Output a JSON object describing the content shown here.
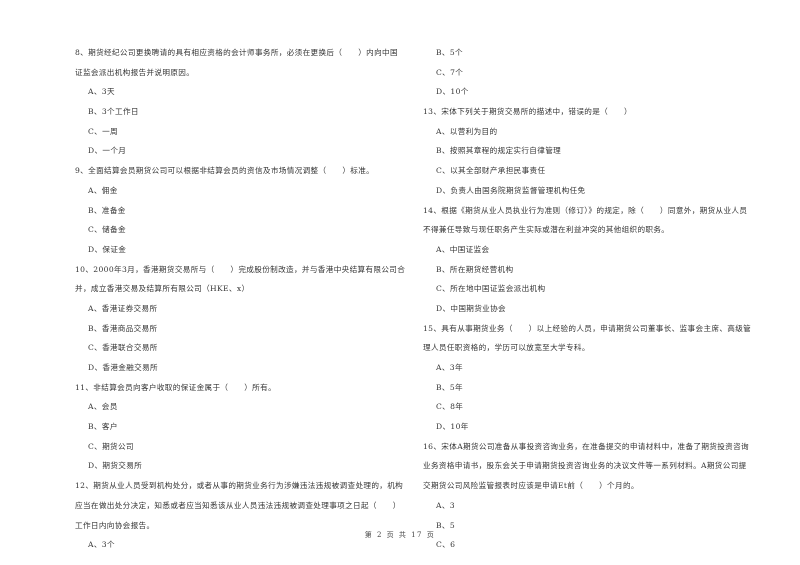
{
  "document": {
    "left_column": [
      {
        "type": "q",
        "text": "8、期货经纪公司更换聘请的具有相应资格的会计师事务所，必须在更换后（　　）内向中国"
      },
      {
        "type": "q",
        "text": "证监会派出机构报告并说明原因。"
      },
      {
        "type": "opt",
        "text": "A、3天"
      },
      {
        "type": "opt",
        "text": "B、3个工作日"
      },
      {
        "type": "opt",
        "text": "C、一周"
      },
      {
        "type": "opt",
        "text": "D、一个月"
      },
      {
        "type": "q",
        "text": "9、全面结算会员期货公司可以根据非结算会员的资信及市场情况调整（　　）标准。"
      },
      {
        "type": "opt",
        "text": "A、佣金"
      },
      {
        "type": "opt",
        "text": "B、准备金"
      },
      {
        "type": "opt",
        "text": "C、储备金"
      },
      {
        "type": "opt",
        "text": "D、保证金"
      },
      {
        "type": "q",
        "text": "10、2000年3月，香港期货交易所与（　　）完成股份制改造，并与香港中央结算有限公司合"
      },
      {
        "type": "q",
        "text": "并，成立香港交易及结算所有限公司（HKE、x）"
      },
      {
        "type": "opt",
        "text": "A、香港证券交易所"
      },
      {
        "type": "opt",
        "text": "B、香港商品交易所"
      },
      {
        "type": "opt",
        "text": "C、香港联合交易所"
      },
      {
        "type": "opt",
        "text": "D、香港金融交易所"
      },
      {
        "type": "q",
        "text": "11、非结算会员向客户收取的保证金属于（　　）所有。"
      },
      {
        "type": "opt",
        "text": "A、会员"
      },
      {
        "type": "opt",
        "text": "B、客户"
      },
      {
        "type": "opt",
        "text": "C、期货公司"
      },
      {
        "type": "opt",
        "text": "D、期货交易所"
      },
      {
        "type": "q",
        "text": "12、期货从业人员受到机构处分，或者从事的期货业务行为涉嫌违法违规被调查处理的，机构"
      },
      {
        "type": "q",
        "text": "应当在做出处分决定，知悉或者应当知悉该从业人员违法违规被调查处理事项之日起（　　）"
      },
      {
        "type": "q",
        "text": "工作日内向协会报告。"
      },
      {
        "type": "opt",
        "text": "A、3个"
      }
    ],
    "right_column": [
      {
        "type": "opt",
        "text": "B、5个"
      },
      {
        "type": "opt",
        "text": "C、7个"
      },
      {
        "type": "opt",
        "text": "D、10个"
      },
      {
        "type": "q",
        "text": "13、宋体下列关于期货交易所的描述中，错误的是（　　）"
      },
      {
        "type": "opt",
        "text": "A、以营利为目的"
      },
      {
        "type": "opt",
        "text": "B、按照其章程的规定实行自律管理"
      },
      {
        "type": "opt",
        "text": "C、以其全部财产承担民事责任"
      },
      {
        "type": "opt",
        "text": "D、负责人由国务院期货监督管理机构任免"
      },
      {
        "type": "q",
        "text": "14、根据《期货从业人员执业行为准则（修订）》的规定，除（　　）同意外，期货从业人员"
      },
      {
        "type": "q",
        "text": "不得兼任导致与现任职务产生实际或潜在利益冲突的其他组织的职务。"
      },
      {
        "type": "opt",
        "text": "A、中国证监会"
      },
      {
        "type": "opt",
        "text": "B、所在期货经营机构"
      },
      {
        "type": "opt",
        "text": "C、所在地中国证监会派出机构"
      },
      {
        "type": "opt",
        "text": "D、中国期货业协会"
      },
      {
        "type": "q",
        "text": "15、具有从事期货业务（　　）以上经验的人员，申请期货公司董事长、监事会主席、高级管"
      },
      {
        "type": "q",
        "text": "理人员任职资格的，学历可以放宽至大学专科。"
      },
      {
        "type": "opt",
        "text": "A、3年"
      },
      {
        "type": "opt",
        "text": "B、5年"
      },
      {
        "type": "opt",
        "text": "C、8年"
      },
      {
        "type": "opt",
        "text": "D、10年"
      },
      {
        "type": "q",
        "text": "16、宋体A期货公司准备从事投资咨询业务，在准备提交的申请材料中，准备了期货投资咨询"
      },
      {
        "type": "q",
        "text": "业务资格申请书，股东会关于申请期货投资咨询业务的决议文件等一系列材料。A期货公司提"
      },
      {
        "type": "q",
        "text": "交期货公司风险监管报表时应该是申请Et前（　　）个月的。"
      },
      {
        "type": "opt",
        "text": "A、3"
      },
      {
        "type": "opt",
        "text": "B、5"
      },
      {
        "type": "opt",
        "text": "C、6"
      }
    ],
    "footer": "第 2 页 共 17 页"
  }
}
